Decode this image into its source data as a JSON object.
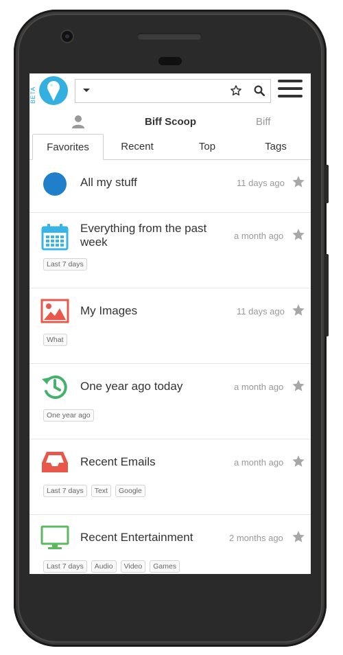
{
  "header": {
    "beta_label": "BETA",
    "search_value": ""
  },
  "user_row": {
    "scoop_name": "Biff Scoop",
    "user_name": "Biff"
  },
  "tabs": [
    {
      "label": "Favorites",
      "active": true
    },
    {
      "label": "Recent",
      "active": false
    },
    {
      "label": "Top",
      "active": false
    },
    {
      "label": "Tags",
      "active": false
    }
  ],
  "items": [
    {
      "icon": "blue-dot-icon",
      "title": "All my stuff",
      "time": "11 days ago",
      "tags": []
    },
    {
      "icon": "calendar-icon",
      "title": "Everything from the past week",
      "time": "a month ago",
      "tags": [
        "Last 7 days"
      ]
    },
    {
      "icon": "image-icon",
      "title": "My Images",
      "time": "11 days ago",
      "tags": [
        "What"
      ]
    },
    {
      "icon": "history-clock-icon",
      "title": "One year ago today",
      "time": "a month ago",
      "tags": [
        "One year ago"
      ]
    },
    {
      "icon": "inbox-tray-icon",
      "title": "Recent Emails",
      "time": "a month ago",
      "tags": [
        "Last 7 days",
        "Text",
        "Google"
      ]
    },
    {
      "icon": "monitor-icon",
      "title": "Recent Entertainment",
      "time": "2 months ago",
      "tags": [
        "Last 7 days",
        "Audio",
        "Video",
        "Games"
      ]
    }
  ],
  "colors": {
    "accent_blue": "#34b0e0",
    "dot_blue": "#1f7fc8",
    "calendar": "#39b4e6",
    "image_red": "#e8574a",
    "clock_green": "#43b26a",
    "inbox_red": "#e8574a",
    "monitor_green": "#5cb85c",
    "star_gray": "#a7a7a7"
  }
}
